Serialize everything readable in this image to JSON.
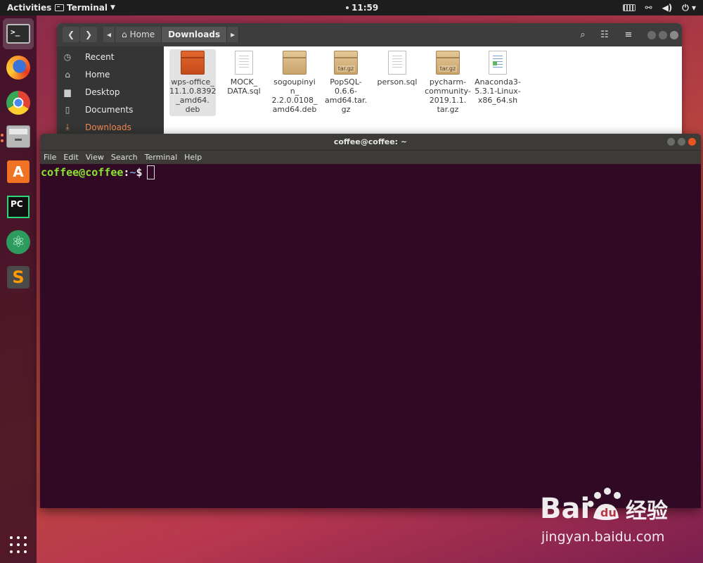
{
  "topbar": {
    "activities": "Activities",
    "app_name": "Terminal",
    "clock": "11:59"
  },
  "dock": {
    "apps": [
      {
        "name": "terminal-icon"
      },
      {
        "name": "firefox-icon"
      },
      {
        "name": "chrome-icon"
      },
      {
        "name": "files-icon"
      },
      {
        "name": "software-store-icon"
      },
      {
        "name": "pycharm-icon",
        "label": "PC"
      },
      {
        "name": "atom-icon"
      },
      {
        "name": "sublime-icon",
        "label": "S"
      }
    ]
  },
  "files": {
    "path": {
      "home": "Home",
      "current": "Downloads"
    },
    "sidebar": [
      {
        "label": "Recent",
        "icon": "clock-icon"
      },
      {
        "label": "Home",
        "icon": "home-icon"
      },
      {
        "label": "Desktop",
        "icon": "folder-icon"
      },
      {
        "label": "Documents",
        "icon": "document-icon"
      },
      {
        "label": "Downloads",
        "icon": "download-icon"
      }
    ],
    "items": [
      {
        "name": "wps-office_\n11.1.0.8392\n_amd64.\ndeb",
        "icon": "package-icon",
        "tag": ""
      },
      {
        "name": "MOCK_\nDATA.sql",
        "icon": "text-file-icon",
        "tag": ""
      },
      {
        "name": "sogoupinyi\nn_\n2.2.0.0108_\namd64.deb",
        "icon": "package-icon",
        "tag": ""
      },
      {
        "name": "PopSQL-\n0.6.6-\namd64.tar.\ngz",
        "icon": "archive-icon",
        "tag": "tar.gz"
      },
      {
        "name": "person.sql",
        "icon": "text-file-icon",
        "tag": ""
      },
      {
        "name": "pycharm-\ncommunity-\n2019.1.1.\ntar.gz",
        "icon": "archive-icon",
        "tag": "tar.gz"
      },
      {
        "name": "Anaconda3-\n5.3.1-Linux-\nx86_64.sh",
        "icon": "script-file-icon",
        "tag": ""
      }
    ]
  },
  "terminal": {
    "title": "coffee@coffee: ~",
    "menu": [
      "File",
      "Edit",
      "View",
      "Search",
      "Terminal",
      "Help"
    ],
    "prompt_user": "coffee@coffee",
    "prompt_colon": ":",
    "prompt_path": "~",
    "prompt_symbol": "$"
  },
  "watermark": {
    "logo": "Bai du 经验",
    "sub": "jingyan.baidu.com"
  },
  "colors": {
    "accent": "#e95420",
    "prompt_user": "#8ae234",
    "prompt_path": "#729fcf",
    "terminal_bg": "#300a24"
  }
}
